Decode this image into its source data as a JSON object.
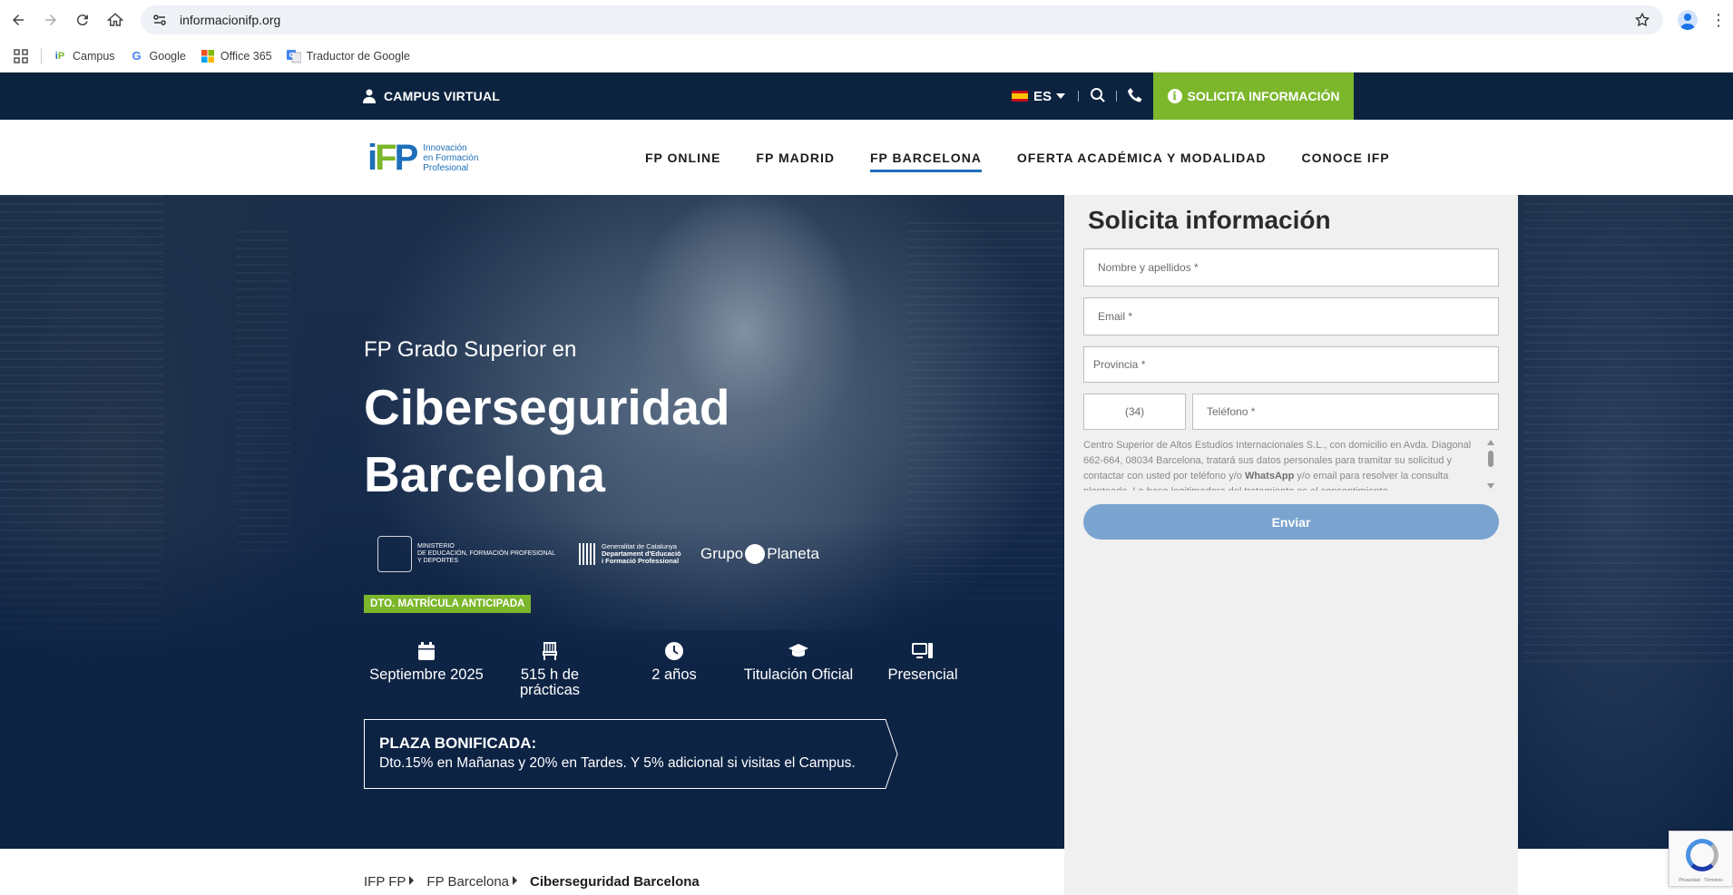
{
  "browser": {
    "url": "informacionifp.org",
    "bookmarks": [
      {
        "label": "Campus",
        "icon": "ifp-favicon"
      },
      {
        "label": "Google",
        "icon": "google-favicon"
      },
      {
        "label": "Office 365",
        "icon": "office-favicon"
      },
      {
        "label": "Traductor de Google",
        "icon": "translate-favicon"
      }
    ]
  },
  "topbar": {
    "campus_label": "CAMPUS VIRTUAL",
    "language": "ES",
    "cta_label": "SOLICITA INFORMACIÓN",
    "cta_color": "#7bb62b",
    "bg_color": "#0c2340"
  },
  "header": {
    "logo_text": [
      "Innovación",
      "en Formación",
      "Profesional"
    ],
    "nav": [
      "FP ONLINE",
      "FP MADRID",
      "FP BARCELONA",
      "OFERTA ACADÉMICA Y MODALIDAD",
      "CONOCE IFP"
    ],
    "active_nav": "FP BARCELONA"
  },
  "hero": {
    "subtitle": "FP Grado Superior en",
    "title_line1": "Ciberseguridad",
    "title_line2": "Barcelona",
    "accreditations": {
      "ministry": [
        "MINISTERIO",
        "DE EDUCACIÓN, FORMACIÓN PROFESIONAL",
        "Y DEPORTES"
      ],
      "gencat": [
        "Generalitat de Catalunya",
        "Departament d'Educació",
        "i Formació Professional"
      ],
      "planeta_left": "Grupo",
      "planeta_right": "Planeta"
    },
    "badge": "DTO. MATRÍCULA ANTICIPADA",
    "features": [
      {
        "icon": "calendar-icon",
        "label": "Septiembre 2025"
      },
      {
        "icon": "chair-icon",
        "label": "515 h de prácticas"
      },
      {
        "icon": "clock-icon",
        "label": "2 años"
      },
      {
        "icon": "graduation-cap-icon",
        "label": "Titulación Oficial"
      },
      {
        "icon": "desktop-icon",
        "label": "Presencial"
      }
    ],
    "promo": {
      "title": "PLAZA BONIFICADA:",
      "text": "Dto.15% en Mañanas y 20% en Tardes. Y 5% adicional si visitas el Campus."
    }
  },
  "form": {
    "title": "Solicita información",
    "name_placeholder": "Nombre y apellidos *",
    "email_placeholder": "Email *",
    "province_placeholder": "Provincia *",
    "prefix": "(34)",
    "phone_placeholder": "Teléfono *",
    "legal_before": "Centro Superior de Altos Estudios Internacionales S.L., con domicilio en Avda. Diagonal 662-664, 08034 Barcelona, tratará sus datos personales para tramitar su solicitud y contactar con usted por teléfono y/o ",
    "legal_bold": "WhatsApp",
    "legal_after": " y/o email para resolver la consulta planteada. La base legitimadora del tratamiento es el consentimiento",
    "submit_label": "Enviar",
    "submit_color": "#7aa4cf"
  },
  "breadcrumb": [
    "IFP FP",
    "FP Barcelona",
    "Ciberseguridad Barcelona"
  ],
  "recaptcha": {
    "text": "Privacidad - Términos"
  }
}
